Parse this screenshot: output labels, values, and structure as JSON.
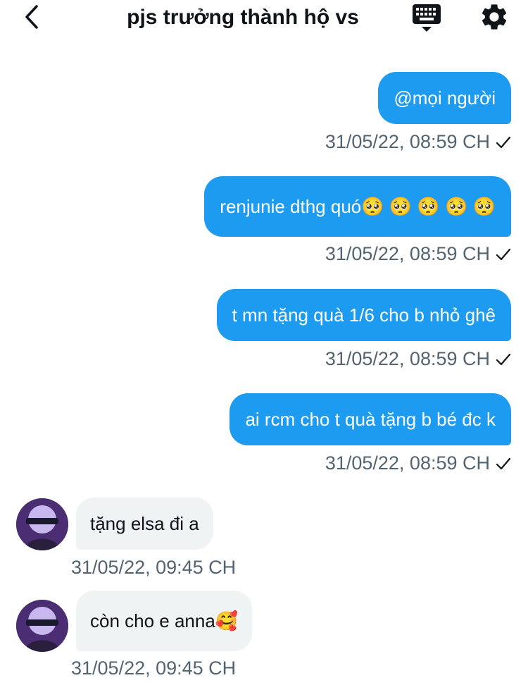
{
  "header": {
    "title": "pjs trưởng thành hộ vs",
    "back_icon": "chevron-left-icon",
    "keyboard_icon": "keyboard-icon",
    "settings_icon": "gear-icon"
  },
  "colors": {
    "accent": "#1d9bf0",
    "incoming_bubble": "#eff3f4",
    "meta_text": "#536471"
  },
  "messages": [
    {
      "direction": "outgoing",
      "text": "@mọi người",
      "time": "31/05/22, 08:59 CH",
      "status": "sent-check"
    },
    {
      "direction": "outgoing",
      "text": "renjunie dthg quó🥺 🥺 🥺 🥺 🥺",
      "time": "31/05/22, 08:59 CH",
      "status": "sent-check"
    },
    {
      "direction": "outgoing",
      "text": "t mn tặng quà 1/6 cho b nhỏ ghê",
      "time": "31/05/22, 08:59 CH",
      "status": "sent-check"
    },
    {
      "direction": "outgoing",
      "text": "ai rcm cho t quà tặng b bé đc k",
      "time": "31/05/22, 08:59 CH",
      "status": "sent-check"
    },
    {
      "direction": "incoming",
      "text": "tặng elsa đi a",
      "time": "31/05/22, 09:45 CH"
    },
    {
      "direction": "incoming",
      "text": "còn cho e anna🥰",
      "time": "31/05/22, 09:45 CH"
    }
  ]
}
